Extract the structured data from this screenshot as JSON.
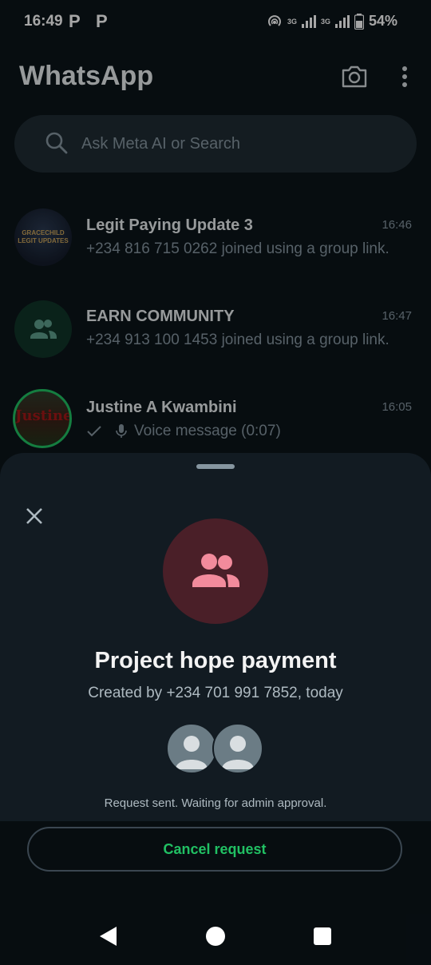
{
  "status_bar": {
    "time": "16:49",
    "notif_icons": [
      "P",
      "P"
    ],
    "network_labels": [
      "3G",
      "3G"
    ],
    "battery": "54%"
  },
  "header": {
    "title": "WhatsApp",
    "camera_icon": "camera-icon",
    "menu_icon": "more-vert-icon"
  },
  "search": {
    "placeholder": "Ask Meta AI or Search"
  },
  "chats": [
    {
      "name": "Legit Paying Update 3",
      "time": "16:46",
      "message": "+234 816 715 0262 joined using a group link.",
      "avatar_text": [
        "GRACECHILD",
        "LEGIT UPDATES"
      ]
    },
    {
      "name": "EARN COMMUNITY",
      "time": "16:47",
      "message": "+234 913 100 1453 joined using a group link."
    },
    {
      "name": "Justine A Kwambini",
      "time": "16:05",
      "message": "Voice message (0:07)",
      "avatar_text": "Justine"
    }
  ],
  "sheet": {
    "title": "Project hope payment",
    "subtitle": "Created by +234 701 991 7852, today",
    "note": "Request sent. Waiting for admin approval.",
    "cancel_label": "Cancel request"
  },
  "colors": {
    "accent_green": "#21c063",
    "group_avatar_bg": "#4a1f28",
    "group_icon": "#f28b9c"
  }
}
